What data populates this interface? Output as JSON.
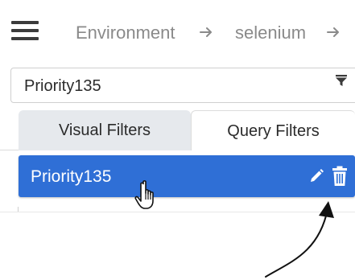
{
  "breadcrumb": {
    "items": [
      "Environment",
      "selenium"
    ]
  },
  "filter_select": {
    "value": "Priority135"
  },
  "tabs": [
    {
      "label": "Visual Filters",
      "active": true
    },
    {
      "label": "Query Filters",
      "active": false
    }
  ],
  "filters_list": {
    "items": [
      {
        "label": "Priority135",
        "selected": true
      }
    ]
  },
  "icons": {
    "menu": "hamburger-menu-icon",
    "crumb_separator": "arrow-right-icon",
    "filter": "funnel-icon",
    "edit": "pencil-icon",
    "delete": "trash-icon",
    "cursor": "hand-pointer-icon"
  },
  "colors": {
    "selected_row": "#2f6fd6",
    "active_tab": "#e6e9ed",
    "breadcrumb_text": "#8a8a8a"
  }
}
